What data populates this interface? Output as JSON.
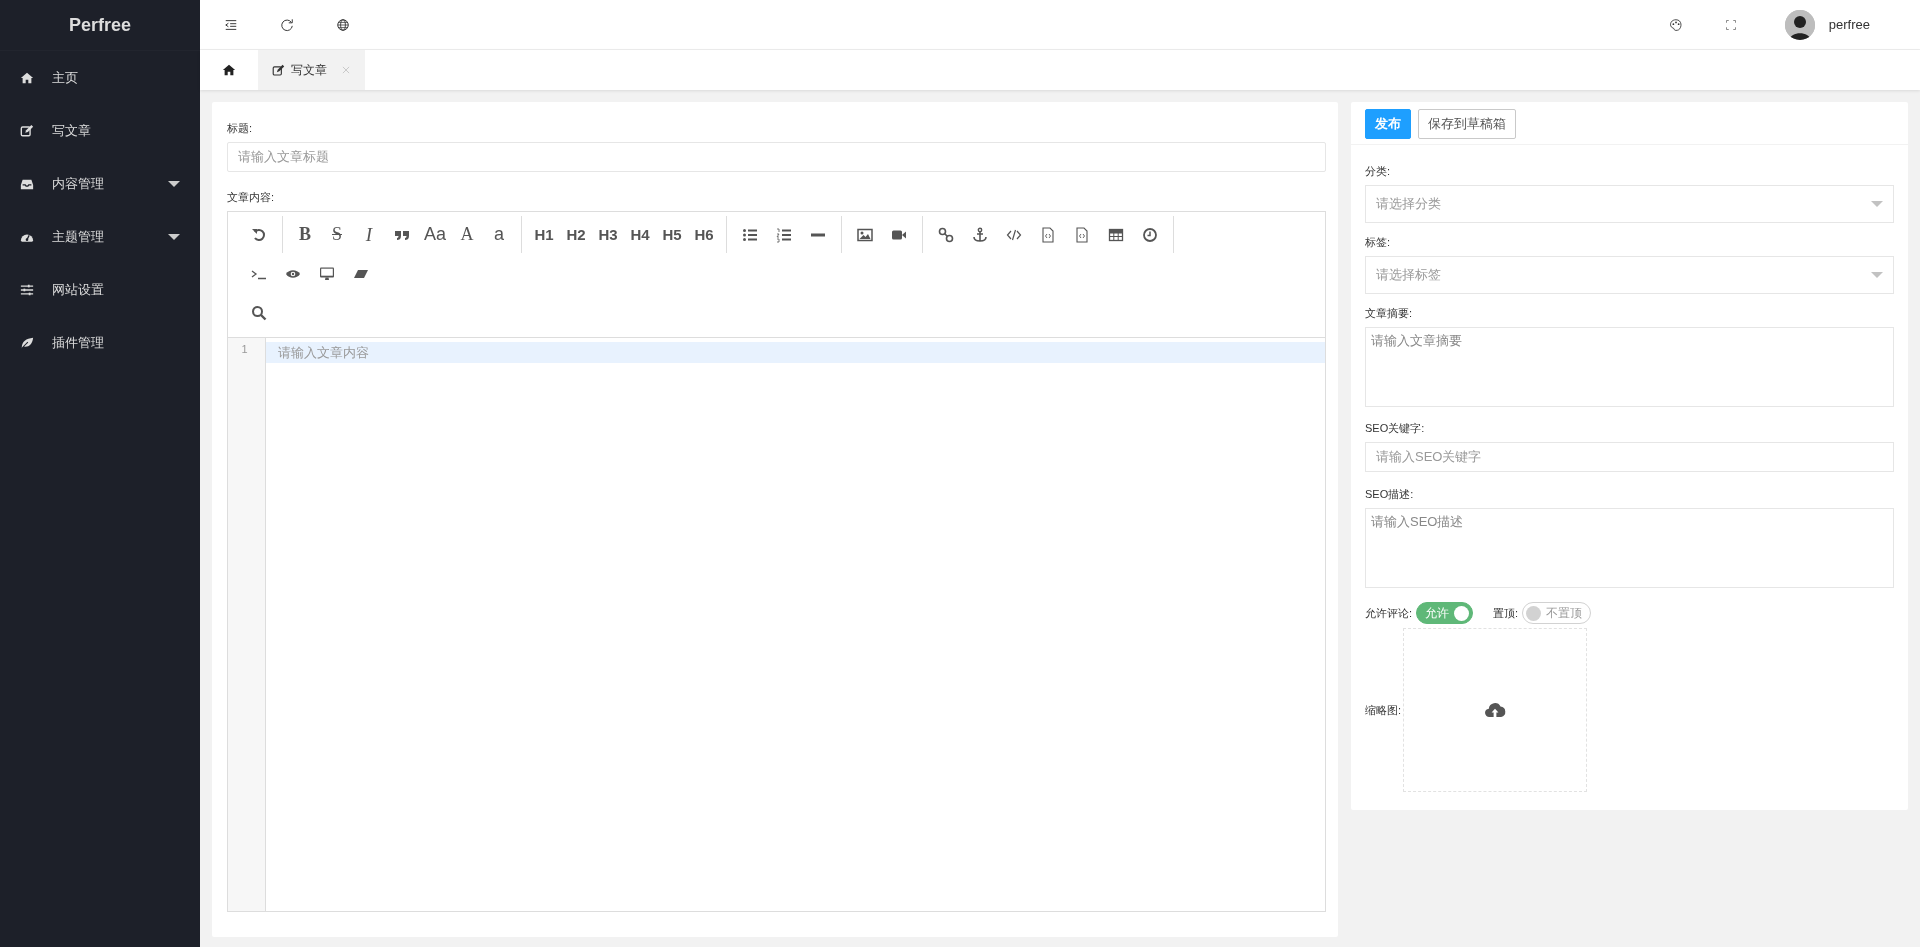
{
  "sidebar": {
    "logo": "Perfree",
    "items": [
      {
        "label": "主页"
      },
      {
        "label": "写文章"
      },
      {
        "label": "内容管理",
        "expanded": false
      },
      {
        "label": "主题管理",
        "expanded": false
      },
      {
        "label": "网站设置"
      },
      {
        "label": "插件管理"
      }
    ]
  },
  "header": {
    "user": "perfree"
  },
  "tabs": [
    {
      "kind": "home",
      "selected": false
    },
    {
      "kind": "page",
      "label": "写文章",
      "selected": true,
      "closable": true
    }
  ],
  "editor_form": {
    "title_label": "标题:",
    "title_placeholder": "请输入文章标题",
    "content_label": "文章内容:",
    "toolbar": [
      [
        {
          "kind": "icon"
        }
      ],
      [
        {
          "kind": "bold",
          "text": "B"
        },
        {
          "kind": "strike",
          "text": "S"
        },
        {
          "kind": "italic",
          "text": "I"
        },
        {
          "kind": "icon"
        },
        {
          "kind": "plain",
          "text": "Aa"
        },
        {
          "kind": "serif",
          "text": "A"
        },
        {
          "kind": "plain",
          "text": "a"
        }
      ],
      [
        {
          "kind": "heading",
          "text": "H1"
        },
        {
          "kind": "heading",
          "text": "H2"
        },
        {
          "kind": "heading",
          "text": "H3"
        },
        {
          "kind": "heading",
          "text": "H4"
        },
        {
          "kind": "heading",
          "text": "H5"
        },
        {
          "kind": "heading",
          "text": "H6"
        }
      ],
      [
        {
          "kind": "icon"
        },
        {
          "kind": "icon"
        },
        {
          "kind": "icon"
        }
      ],
      [
        {
          "kind": "icon"
        },
        {
          "kind": "icon"
        }
      ],
      [
        {
          "kind": "icon"
        },
        {
          "kind": "icon"
        },
        {
          "kind": "icon"
        },
        {
          "kind": "icon"
        },
        {
          "kind": "icon"
        },
        {
          "kind": "icon"
        },
        {
          "kind": "icon"
        }
      ],
      [
        {
          "kind": "icon"
        },
        {
          "kind": "icon"
        },
        {
          "kind": "icon"
        },
        {
          "kind": "icon"
        }
      ],
      [
        {
          "kind": "icon"
        }
      ]
    ],
    "line_number": "1",
    "content_placeholder": "请输入文章内容"
  },
  "side_form": {
    "buttons": [
      {
        "label": "发布",
        "kind": "primary"
      },
      {
        "label": "保存到草稿箱",
        "kind": "default"
      }
    ],
    "fields": [
      {
        "kind": "select",
        "label": "分类:",
        "placeholder": "请选择分类"
      },
      {
        "kind": "select",
        "label": "标签:",
        "placeholder": "请选择标签"
      },
      {
        "kind": "textarea",
        "label": "文章摘要:",
        "placeholder": "请输入文章摘要"
      },
      {
        "kind": "input",
        "label": "SEO关键字:",
        "placeholder": "请输入SEO关键字"
      },
      {
        "kind": "textarea",
        "label": "SEO描述:",
        "placeholder": "请输入SEO描述"
      }
    ],
    "switches": [
      {
        "label": "允许评论:",
        "text": "允许",
        "on": true
      },
      {
        "label": "置顶:",
        "text": "不置顶",
        "on": false
      }
    ],
    "thumbnail_label": "缩略图:"
  }
}
